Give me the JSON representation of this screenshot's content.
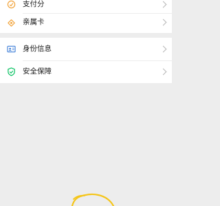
{
  "menu_group_1": {
    "items": [
      {
        "label": "支付分",
        "icon": "payscore-icon"
      },
      {
        "label": "亲属卡",
        "icon": "family-card-icon"
      }
    ]
  },
  "menu_group_2": {
    "items": [
      {
        "label": "身份信息",
        "icon": "id-card-icon"
      },
      {
        "label": "安全保障",
        "icon": "shield-check-icon"
      }
    ]
  },
  "colors": {
    "icon_orange": "#f2a33a",
    "icon_blue": "#3f7fd8",
    "icon_green": "#07c160",
    "background": "#ededed",
    "annotation_yellow": "#f5c518"
  }
}
